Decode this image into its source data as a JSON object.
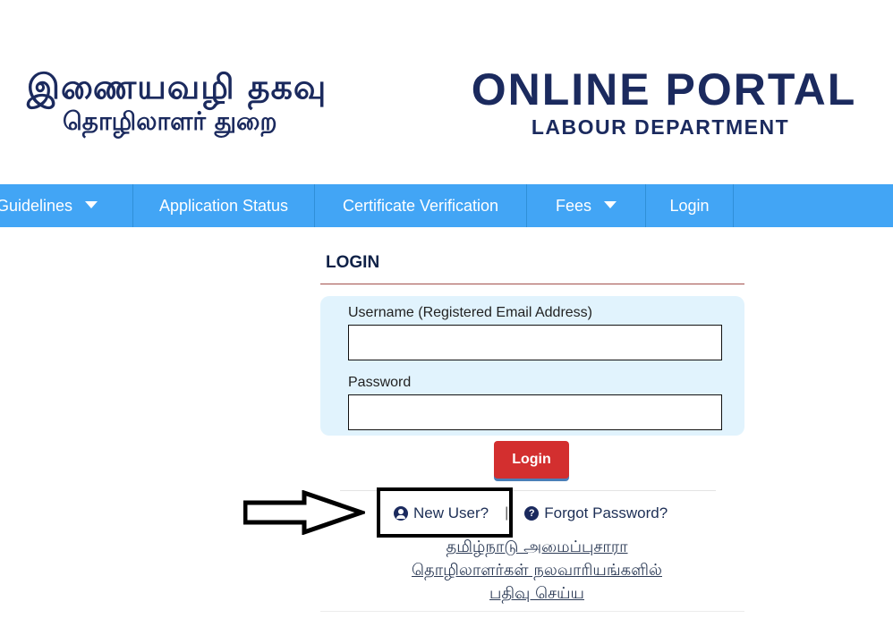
{
  "header": {
    "tamil_logo_line1": "இணையவழி தகவு",
    "tamil_logo_line2": "தொழிலாளர் துறை",
    "english_logo_title": "ONLINE PORTAL",
    "english_logo_subtitle": "LABOUR DEPARTMENT"
  },
  "nav": {
    "items": [
      {
        "label": "Guidelines",
        "has_dropdown": true
      },
      {
        "label": "Application Status",
        "has_dropdown": false
      },
      {
        "label": "Certificate Verification",
        "has_dropdown": false
      },
      {
        "label": "Fees",
        "has_dropdown": true
      },
      {
        "label": "Login",
        "has_dropdown": false
      }
    ],
    "background_color": "#42a5f5"
  },
  "login": {
    "heading": "LOGIN",
    "username_label": "Username (Registered Email Address)",
    "username_value": "",
    "password_label": "Password",
    "password_value": "",
    "submit_label": "Login",
    "submit_color": "#d32f2f",
    "new_user_label": "New User?",
    "new_user_icon": "user-circle-icon",
    "separator": "|",
    "forgot_password_label": "Forgot Password?",
    "forgot_password_icon": "question-circle-icon",
    "tamil_register_line1": "தமிழ்நாடு அமைப்புசாரா",
    "tamil_register_line2": "தொழிலாளர்கள் நலவாரியங்களில்",
    "tamil_register_line3": "பதிவு செய்ய"
  },
  "annotation": {
    "arrow_icon": "right-arrow-outline-icon",
    "highlight_target": "New User?"
  }
}
